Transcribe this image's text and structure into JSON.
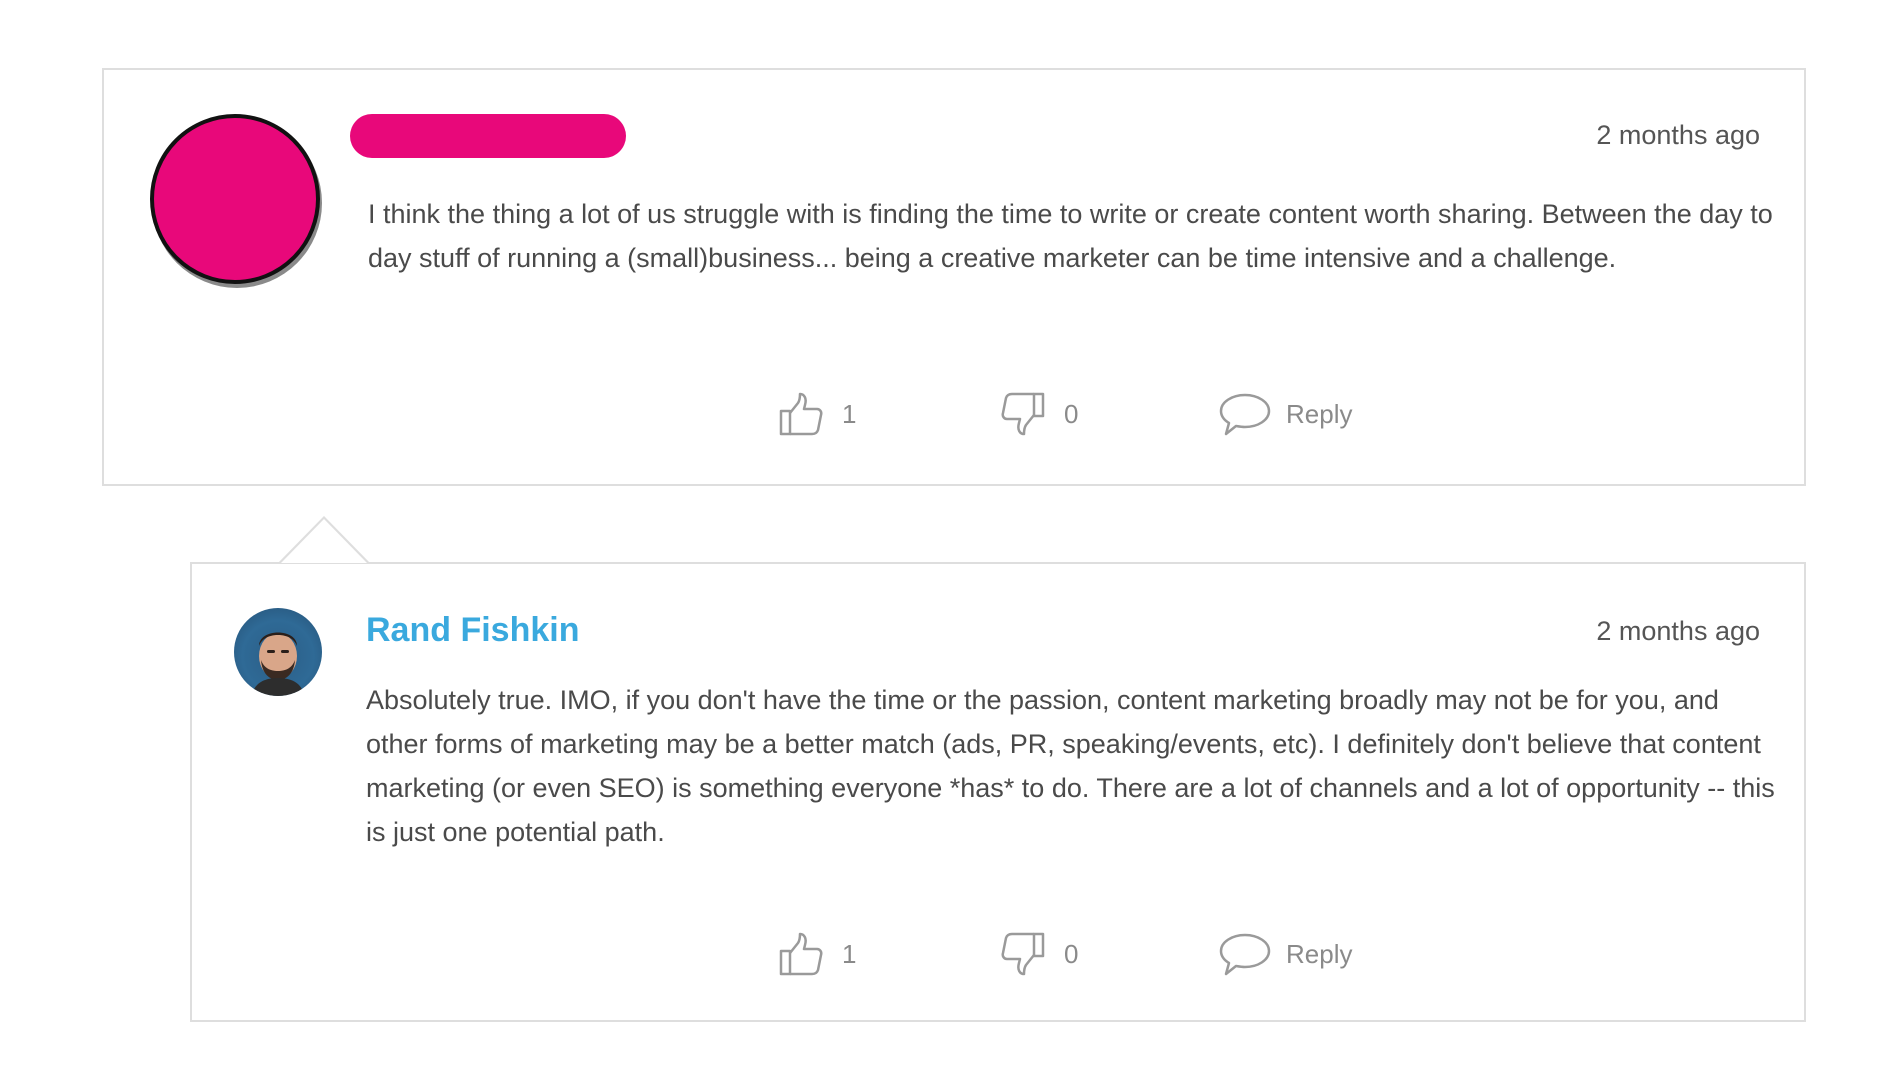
{
  "comments": [
    {
      "author": "",
      "author_redacted": true,
      "redaction_color": "#e8087a",
      "timestamp": "2 months ago",
      "text": "I think the thing a lot of us struggle with is finding the time to write or create content worth sharing. Between the day to day stuff of running a (small)business... being a creative marketer can be time intensive and a challenge.",
      "likes": "1",
      "dislikes": "0",
      "reply_label": "Reply"
    },
    {
      "author": "Rand Fishkin",
      "author_color": "#3aa9de",
      "timestamp": "2 months ago",
      "text": "Absolutely true. IMO, if you don't have the time or the passion, content marketing broadly may not be for you, and other forms of marketing may be a better match (ads, PR, speaking/events, etc). I definitely don't believe that content marketing (or even SEO) is something everyone *has* to do. There are a lot of channels and a lot of opportunity -- this is just one potential path.",
      "likes": "1",
      "dislikes": "0",
      "reply_label": "Reply"
    }
  ],
  "icons": {
    "like": "thumbs-up-icon",
    "dislike": "thumbs-down-icon",
    "reply": "speech-bubble-icon"
  }
}
